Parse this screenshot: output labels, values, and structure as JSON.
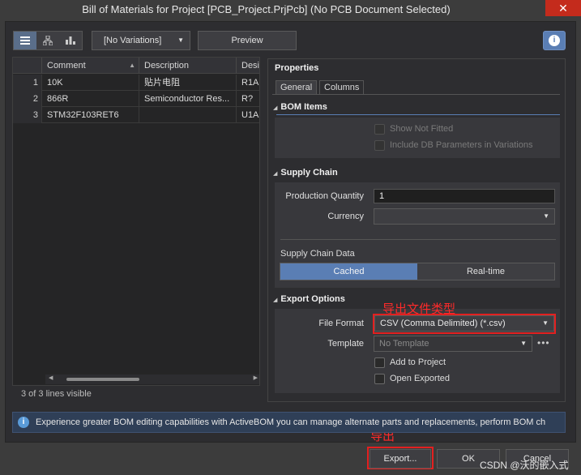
{
  "window": {
    "title": "Bill of Materials for Project [PCB_Project.PrjPcb] (No PCB Document Selected)",
    "close_glyph": "✕"
  },
  "toolbar": {
    "view_icons": [
      "list-view-icon",
      "tree-view-icon",
      "chart-view-icon"
    ],
    "variations_value": "[No Variations]",
    "preview_label": "Preview",
    "info_glyph": "i"
  },
  "grid": {
    "columns": [
      "Comment",
      "Description",
      "Desi"
    ],
    "rows": [
      {
        "num": "1",
        "comment": "10K",
        "description": "贴片电阻",
        "designator": "R1A"
      },
      {
        "num": "2",
        "comment": "866R",
        "description": "Semiconductor Res...",
        "designator": "R?"
      },
      {
        "num": "3",
        "comment": "STM32F103RET6",
        "description": "",
        "designator": "U1A"
      }
    ],
    "status": "3 of 3 lines visible"
  },
  "properties": {
    "title": "Properties",
    "tabs": [
      "General",
      "Columns"
    ],
    "bom_items": {
      "heading": "BOM Items",
      "show_not_fitted": "Show Not Fitted",
      "include_db": "Include DB Parameters in Variations"
    },
    "supply_chain": {
      "heading": "Supply Chain",
      "production_quantity_label": "Production Quantity",
      "production_quantity_value": "1",
      "currency_label": "Currency",
      "currency_value": "",
      "data_label": "Supply Chain Data",
      "cached_label": "Cached",
      "realtime_label": "Real-time"
    },
    "export_options": {
      "heading": "Export Options",
      "file_format_label": "File Format",
      "file_format_value": "CSV (Comma Delimited) (*.csv)",
      "template_label": "Template",
      "template_value": "No Template",
      "template_more": "•••",
      "add_to_project": "Add to Project",
      "open_exported": "Open Exported"
    }
  },
  "annotations": {
    "file_type": "导出文件类型",
    "export": "导出"
  },
  "infobar": {
    "text": "Experience greater BOM editing capabilities with ActiveBOM you can manage alternate parts and replacements, perform BOM ch"
  },
  "buttons": {
    "export": "Export...",
    "ok": "OK",
    "cancel": "Cancel"
  },
  "watermark": "CSDN @沃的嵌入式"
}
